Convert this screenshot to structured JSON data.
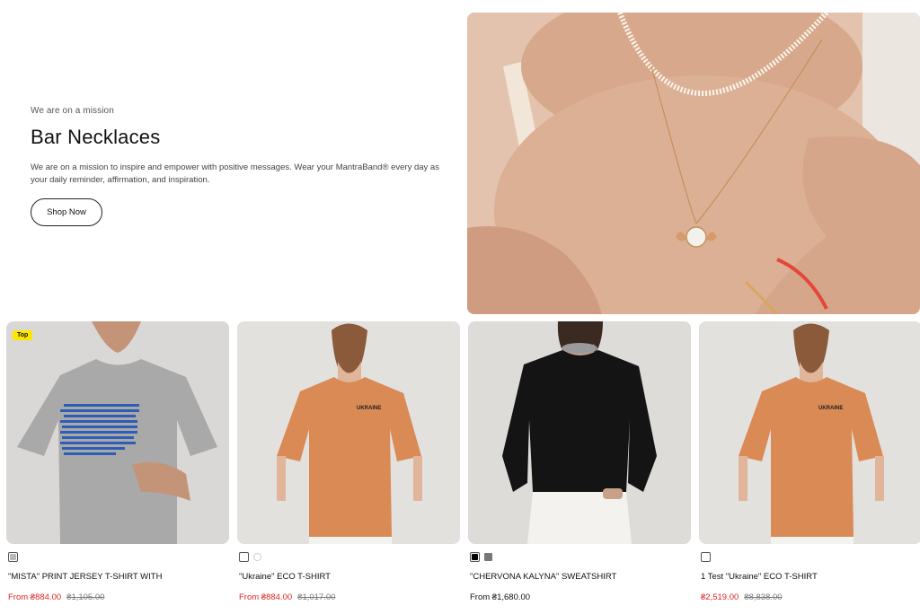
{
  "hero": {
    "eyebrow": "We are on a mission",
    "title": "Bar Necklaces",
    "description": "We are on a mission to inspire and empower with positive messages. Wear your MantraBand® every day as your daily reminder, affirmation, and inspiration.",
    "button_label": "Shop Now"
  },
  "products": [
    {
      "badge": "Top",
      "name": "\"MISTA\" PRINT JERSEY T-SHIRT WITH",
      "price": "From ₴884.00",
      "old_price": "₴1,105.00",
      "shirt_color": "#a9a9a9",
      "bg": "#d9d8d6"
    },
    {
      "badge": "",
      "name": "\"Ukraine\" ECO T-SHIRT",
      "price": "From ₴884.00",
      "old_price": "₴1,017.00",
      "shirt_color": "#d98a55",
      "bg": "#e3e1de",
      "print_text": "UKRAINE"
    },
    {
      "badge": "",
      "name": "\"CHERVONA KALYNA\" SWEATSHIRT",
      "price": "From ₴1,680.00",
      "old_price": "",
      "shirt_color": "#141414",
      "bg": "#dedcd9"
    },
    {
      "badge": "",
      "name": "1 Test \"Ukraine\" ECO T-SHIRT",
      "price": "₴2,519.00",
      "old_price": "₴8,838.00",
      "shirt_color": "#d98a55",
      "bg": "#e3e1de",
      "print_text": "UKRAINE"
    }
  ],
  "colors": {
    "sale_red": "#e02424",
    "badge_yellow": "#ffe600"
  }
}
